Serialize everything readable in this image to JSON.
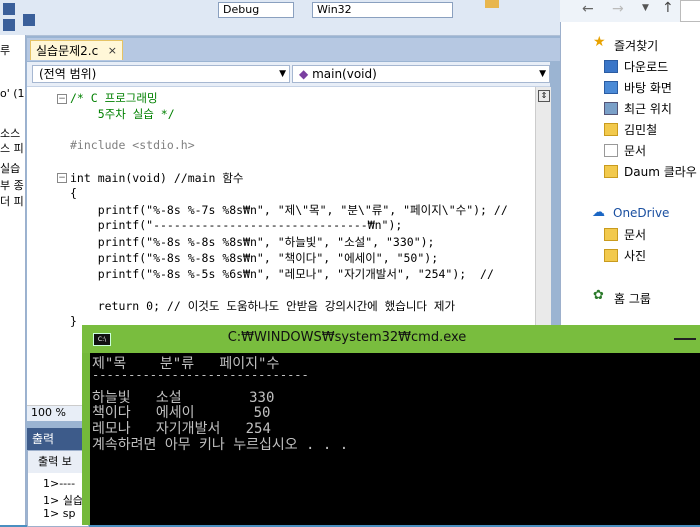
{
  "ide": {
    "toolbar": {
      "config_combo": "Debug",
      "platform_combo": "Win32"
    },
    "left_panel": {
      "lines": [
        "루",
        "o' (1",
        "",
        "소스",
        "스 피",
        "실습",
        "부 종",
        "더 피"
      ]
    },
    "file_tab": {
      "label": "실습문제2.c",
      "close": "×"
    },
    "nav": {
      "scope": "(전역 범위)",
      "function": "main(void)"
    },
    "code_lines": [
      "/* C 프로그래밍",
      "    5주차 실습 */",
      "",
      "#include <stdio.h>",
      "",
      "int main(void) //main 함수",
      "{",
      "    printf(\"%-8s %-7s %8s₩n\", \"제\\\"목\", \"분\\\"류\", \"페이지\\\"수\"); //",
      "    printf(\"-------------------------------₩n\");",
      "    printf(\"%-8s %-8s %8s₩n\", \"하늘빛\", \"소설\", \"330\");",
      "    printf(\"%-8s %-8s %8s₩n\", \"책이다\", \"에세이\", \"50\");",
      "    printf(\"%-8s %-5s %6s₩n\", \"레모나\", \"자기개발서\", \"254\");  //",
      "",
      "    return 0; // 이것도 도움하나도 안받음 강의시간에 했습니다 제가",
      "}"
    ],
    "zoom": "100 %",
    "output": {
      "title": "출력",
      "subtitle": "출력 보",
      "lines": [
        "1>----",
        "1>  실습",
        "1>  sp"
      ]
    }
  },
  "explorer": {
    "favorites_label": "즐겨찾기",
    "items": [
      "다운로드",
      "바탕 화면",
      "최근 위치",
      "김민철",
      "문서",
      "Daum 클라우"
    ],
    "onedrive_label": "OneDrive",
    "onedrive_items": [
      "문서",
      "사진"
    ],
    "homegroup_label": "홈 그룹"
  },
  "cmd": {
    "title": "C:₩WINDOWS₩system32₩cmd.exe",
    "lines": [
      "제\"목    분\"류   페이지\"수",
      "------------------------------",
      "하늘빛   소설        330",
      "책이다   에세이       50",
      "레모나   자기개발서   254",
      "계속하려면 아무 키나 누르십시오 . . ."
    ]
  }
}
